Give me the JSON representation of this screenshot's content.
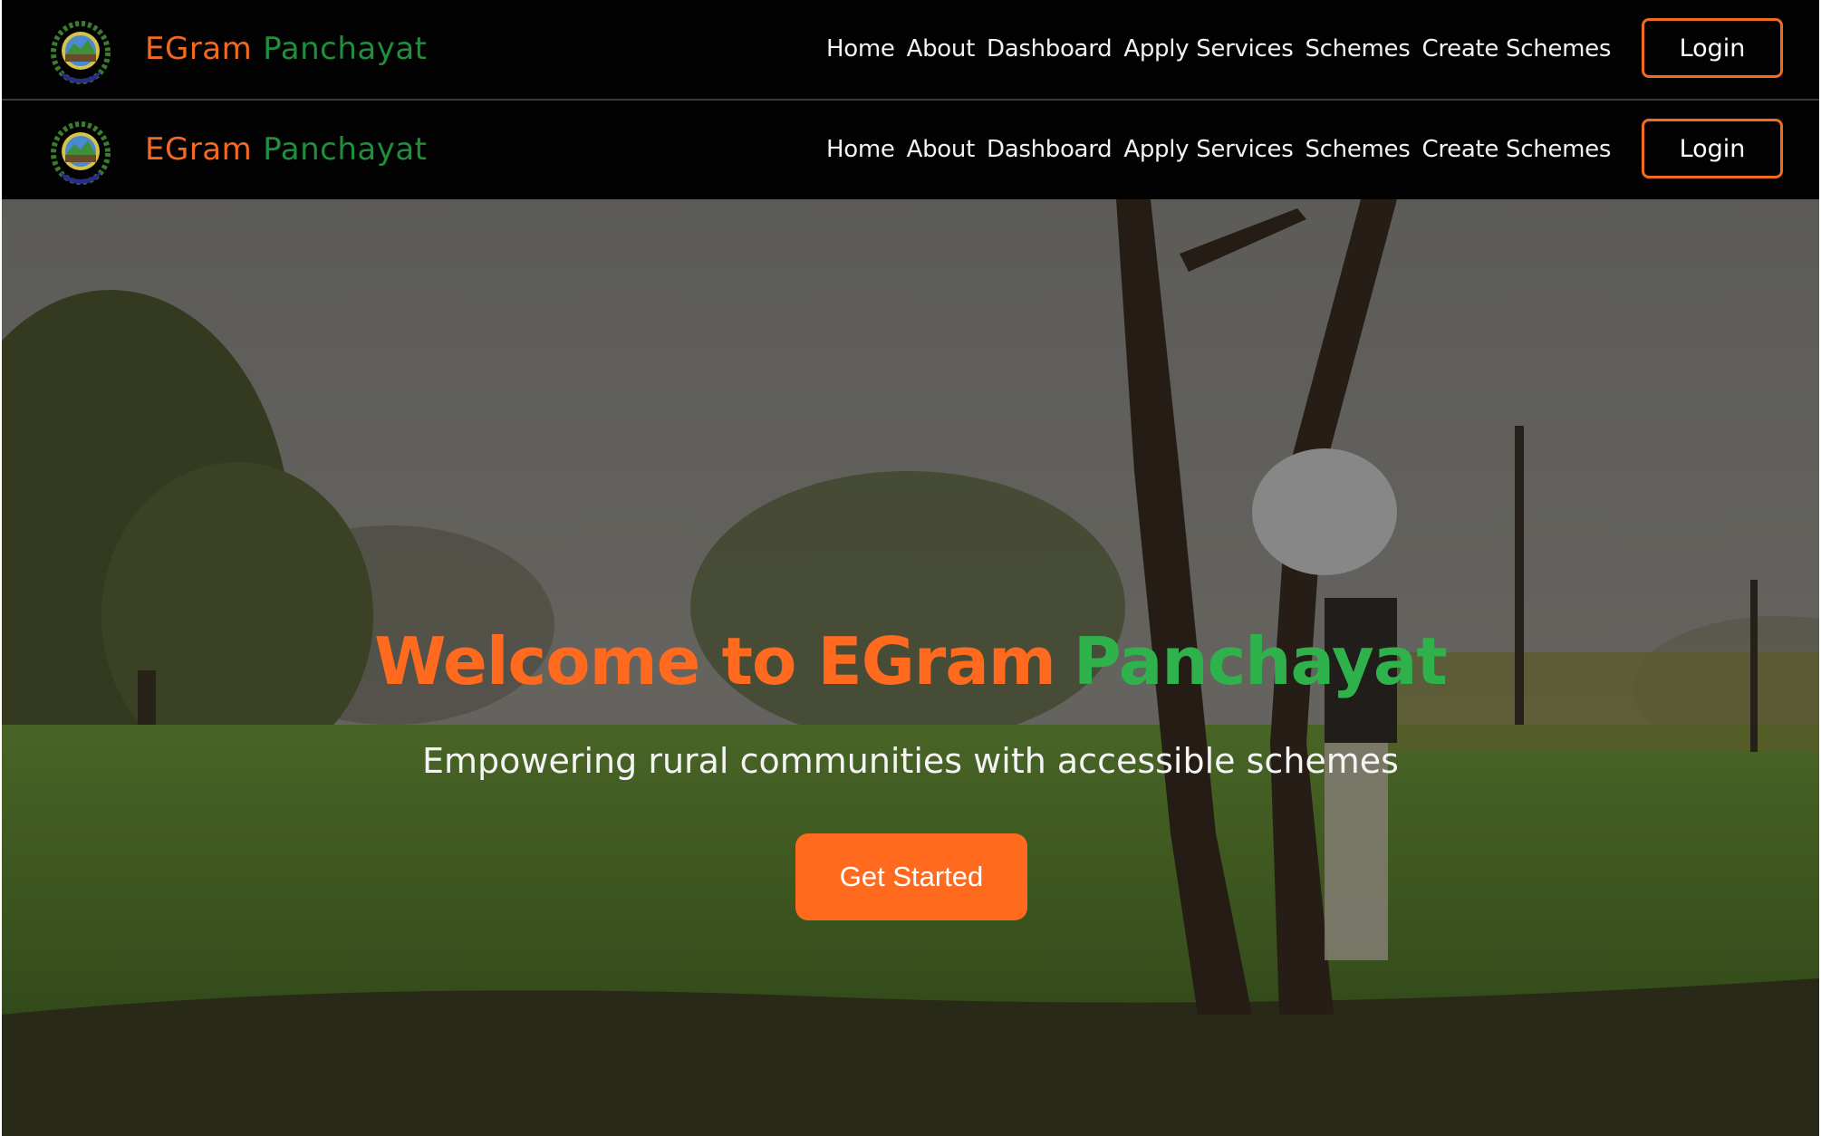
{
  "navbars": [
    {
      "brand": {
        "part1": "EGram",
        "part2": "Panchayat"
      },
      "links": [
        "Home",
        "About",
        "Dashboard",
        "Apply Services",
        "Schemes",
        "Create Schemes"
      ],
      "login_label": "Login"
    },
    {
      "brand": {
        "part1": "EGram",
        "part2": "Panchayat"
      },
      "links": [
        "Home",
        "About",
        "Dashboard",
        "Apply Services",
        "Schemes",
        "Create Schemes"
      ],
      "login_label": "Login"
    }
  ],
  "hero": {
    "title_part1": "Welcome to EGram",
    "title_part2": "Panchayat",
    "subtitle": "Empowering rural communities with accessible schemes",
    "cta_label": "Get Started"
  },
  "colors": {
    "accent_orange": "#ff6a1f",
    "accent_green": "#2fb24c",
    "nav_background": "#020202"
  },
  "icons": {
    "logo": "emblem-logo-icon"
  }
}
